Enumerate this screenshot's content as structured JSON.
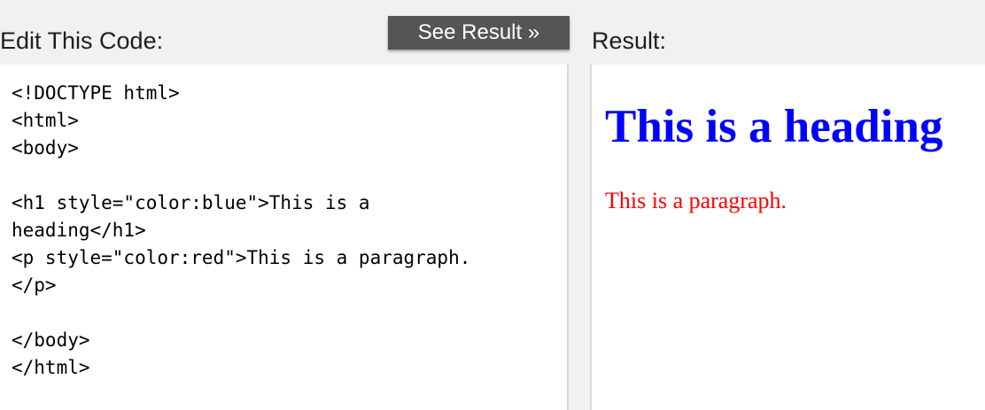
{
  "editor": {
    "label": "Edit This Code:",
    "code": "<!DOCTYPE html>\n<html>\n<body>\n\n<h1 style=\"color:blue\">This is a\nheading</h1>\n<p style=\"color:red\">This is a paragraph.\n</p>\n\n</body>\n</html>"
  },
  "toolbar": {
    "see_result_label": "See Result »"
  },
  "result": {
    "label": "Result:",
    "heading": "This is a heading",
    "heading_color": "#0000ff",
    "paragraph": "This is a paragraph.",
    "paragraph_color": "#ff0000"
  }
}
